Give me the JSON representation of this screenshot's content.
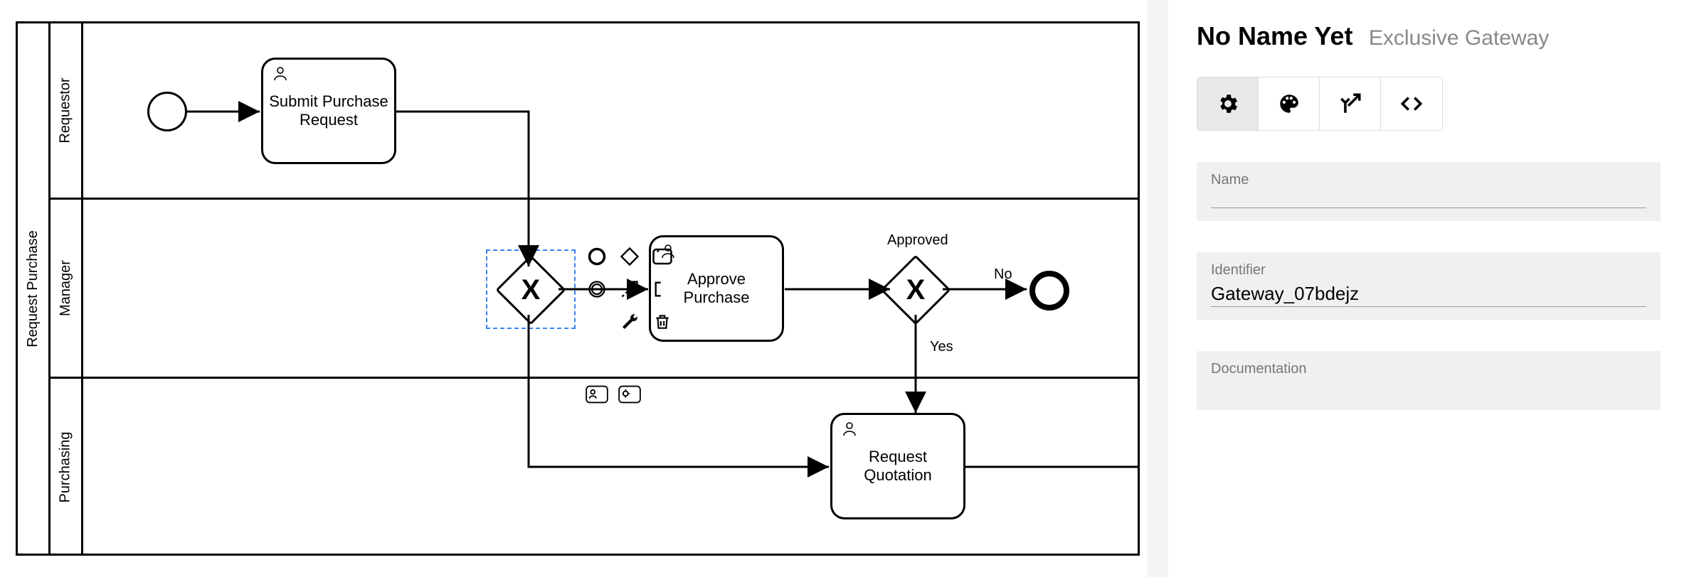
{
  "panel": {
    "title": "No Name Yet",
    "subtype": "Exclusive Gateway",
    "name_label": "Name",
    "name_value": "",
    "identifier_label": "Identifier",
    "identifier_value": "Gateway_07bdejz",
    "documentation_label": "Documentation",
    "documentation_value": ""
  },
  "pool": {
    "label": "Request Purchase",
    "lanes": [
      {
        "id": "requestor",
        "label": "Requestor"
      },
      {
        "id": "manager",
        "label": "Manager"
      },
      {
        "id": "purchasing",
        "label": "Purchasing"
      }
    ]
  },
  "elements": {
    "start_event": {
      "type": "startEvent"
    },
    "task_submit": {
      "type": "userTask",
      "label": "Submit Purchase Request"
    },
    "gateway1": {
      "type": "exclusiveGateway",
      "selected": true
    },
    "task_approve": {
      "type": "userTask",
      "label": "Approve Purchase"
    },
    "gateway2": {
      "type": "exclusiveGateway",
      "label": "Approved"
    },
    "end_event": {
      "type": "endEvent"
    },
    "task_quotation": {
      "type": "userTask",
      "label": "Request Quotation"
    }
  },
  "flows": {
    "no": {
      "label": "No"
    },
    "yes": {
      "label": "Yes"
    }
  },
  "context_pad": {
    "items": [
      {
        "name": "append-end-event-icon"
      },
      {
        "name": "append-gateway-icon"
      },
      {
        "name": "append-task-icon"
      },
      {
        "name": "append-intermediate-event-icon"
      },
      {
        "name": "connect-icon"
      },
      {
        "name": "text-annotation-icon"
      },
      {
        "name": "wrench-icon"
      },
      {
        "name": "delete-icon"
      }
    ],
    "lane_items": [
      {
        "name": "append-user-task-icon"
      },
      {
        "name": "append-service-task-icon"
      }
    ]
  }
}
